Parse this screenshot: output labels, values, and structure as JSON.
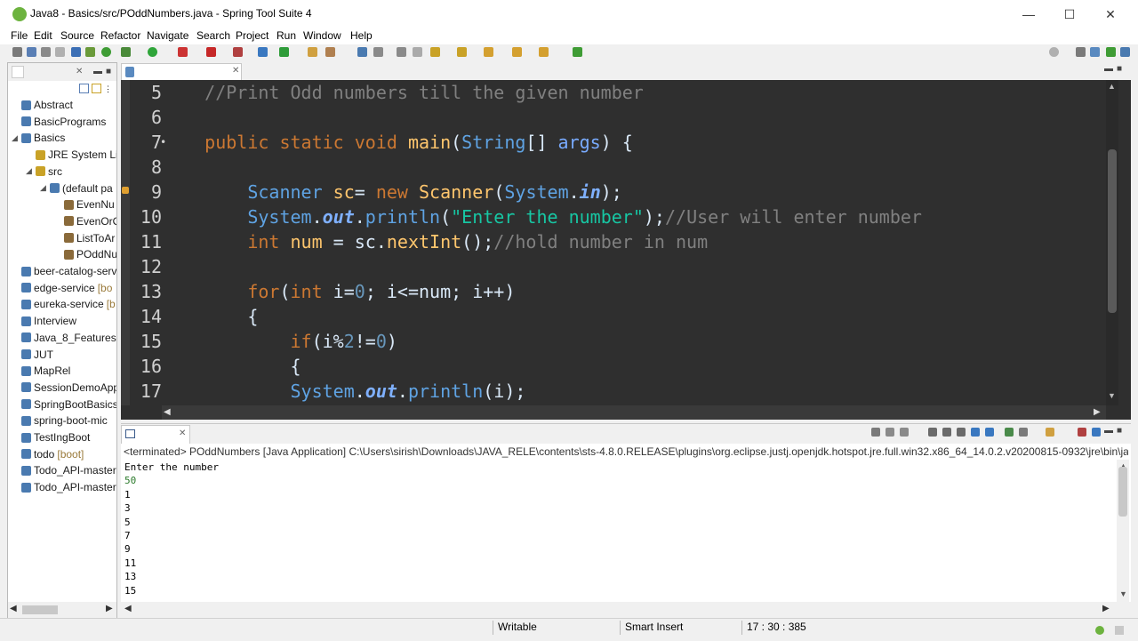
{
  "window": {
    "title": "Java8 - Basics/src/POddNumbers.java - Spring Tool Suite 4",
    "minimize_icon": "minimize-icon",
    "maximize_icon": "maximize-icon",
    "close_icon": "close-icon"
  },
  "menu": [
    "File",
    "Edit",
    "Source",
    "Refactor",
    "Navigate",
    "Search",
    "Project",
    "Run",
    "Window",
    "Help"
  ],
  "package_explorer": {
    "items": [
      {
        "label": "Abstract",
        "level": 0
      },
      {
        "label": "BasicPrograms",
        "level": 0
      },
      {
        "label": "Basics",
        "level": 0,
        "expanded": true
      },
      {
        "label": "JRE System Lib",
        "level": 1
      },
      {
        "label": "src",
        "level": 1,
        "expanded": true
      },
      {
        "label": "(default pa",
        "level": 2,
        "expanded": true
      },
      {
        "label": "EvenNu",
        "level": 3
      },
      {
        "label": "EvenOrO",
        "level": 3
      },
      {
        "label": "ListToAr",
        "level": 3
      },
      {
        "label": "POddNu",
        "level": 3
      },
      {
        "label": "beer-catalog-serv",
        "level": 0
      },
      {
        "label": "edge-service",
        "level": 0,
        "decoration": "[bo"
      },
      {
        "label": "eureka-service",
        "level": 0,
        "decoration": "[b"
      },
      {
        "label": "Interview",
        "level": 0
      },
      {
        "label": "Java_8_Features",
        "level": 0
      },
      {
        "label": "JUT",
        "level": 0
      },
      {
        "label": "MapRel",
        "level": 0
      },
      {
        "label": "SessionDemoApp",
        "level": 0
      },
      {
        "label": "SpringBootBasics",
        "level": 0
      },
      {
        "label": "spring-boot-mic",
        "level": 0
      },
      {
        "label": "TestIngBoot",
        "level": 0
      },
      {
        "label": "todo",
        "level": 0,
        "decoration": "[boot]"
      },
      {
        "label": "Todo_API-master",
        "level": 0
      },
      {
        "label": "Todo_API-master",
        "level": 0
      }
    ]
  },
  "editor": {
    "lines": [
      {
        "n": "5",
        "tokens": [
          [
            "cm",
            "    //Print Odd numbers till the given number"
          ]
        ]
      },
      {
        "n": "6",
        "tokens": []
      },
      {
        "n": "7",
        "marker": "•",
        "tokens": [
          [
            "kw",
            "    public static void "
          ],
          [
            "fn",
            "main"
          ],
          [
            "pl",
            "("
          ],
          [
            "ty",
            "String"
          ],
          [
            "pl",
            "[] "
          ],
          [
            "vr",
            "args"
          ],
          [
            "pl",
            ") {"
          ]
        ]
      },
      {
        "n": "8",
        "tokens": []
      },
      {
        "n": "9",
        "tokens": [
          [
            "ty",
            "        Scanner "
          ],
          [
            "fn",
            "sc"
          ],
          [
            "pl",
            "= "
          ],
          [
            "kw",
            "new "
          ],
          [
            "fn",
            "Scanner"
          ],
          [
            "pl",
            "("
          ],
          [
            "ty",
            "System"
          ],
          [
            "pl",
            "."
          ],
          [
            "it",
            "in"
          ],
          [
            "pl",
            ");"
          ]
        ]
      },
      {
        "n": "10",
        "tokens": [
          [
            "ty",
            "        System"
          ],
          [
            "pl",
            "."
          ],
          [
            "it",
            "out"
          ],
          [
            "pl",
            "."
          ],
          [
            "ty",
            "println"
          ],
          [
            "pl",
            "("
          ],
          [
            "st",
            "\"Enter the number\""
          ],
          [
            "pl",
            ");"
          ],
          [
            "cm",
            "//User will enter number"
          ]
        ]
      },
      {
        "n": "11",
        "tokens": [
          [
            "kw",
            "        int "
          ],
          [
            "fn",
            "num"
          ],
          [
            "pl",
            " = sc."
          ],
          [
            "fn",
            "nextInt"
          ],
          [
            "pl",
            "();"
          ],
          [
            "cm",
            "//hold number in num"
          ]
        ]
      },
      {
        "n": "12",
        "tokens": []
      },
      {
        "n": "13",
        "tokens": [
          [
            "kw",
            "        for"
          ],
          [
            "pl",
            "("
          ],
          [
            "kw",
            "int "
          ],
          [
            "pl",
            "i="
          ],
          [
            "nm",
            "0"
          ],
          [
            "pl",
            "; i<=num; i++)"
          ]
        ]
      },
      {
        "n": "14",
        "tokens": [
          [
            "pl",
            "        {"
          ]
        ]
      },
      {
        "n": "15",
        "tokens": [
          [
            "kw",
            "            if"
          ],
          [
            "pl",
            "(i%"
          ],
          [
            "nm",
            "2"
          ],
          [
            "pl",
            "!="
          ],
          [
            "nm",
            "0"
          ],
          [
            "pl",
            ")"
          ]
        ]
      },
      {
        "n": "16",
        "tokens": [
          [
            "pl",
            "            {"
          ]
        ]
      },
      {
        "n": "17",
        "tokens": [
          [
            "ty",
            "            System"
          ],
          [
            "pl",
            "."
          ],
          [
            "it",
            "out"
          ],
          [
            "pl",
            "."
          ],
          [
            "ty",
            "println"
          ],
          [
            "pl",
            "(i);"
          ]
        ]
      }
    ]
  },
  "console": {
    "header": "<terminated> POddNumbers [Java Application] C:\\Users\\sirish\\Downloads\\JAVA_RELE\\contents\\sts-4.8.0.RELEASE\\plugins\\org.eclipse.justj.openjdk.hotspot.jre.full.win32.x86_64_14.0.2.v20200815-0932\\jre\\bin\\javaw.",
    "output": [
      {
        "text": "Enter the number",
        "type": "out"
      },
      {
        "text": "50",
        "type": "in"
      },
      {
        "text": "1",
        "type": "out"
      },
      {
        "text": "3",
        "type": "out"
      },
      {
        "text": "5",
        "type": "out"
      },
      {
        "text": "7",
        "type": "out"
      },
      {
        "text": "9",
        "type": "out"
      },
      {
        "text": "11",
        "type": "out"
      },
      {
        "text": "13",
        "type": "out"
      },
      {
        "text": "15",
        "type": "out"
      }
    ]
  },
  "status": {
    "writable": "Writable",
    "insert_mode": "Smart Insert",
    "position": "17 : 30 : 385"
  },
  "colors": {
    "editor_bg": "#2f2f2f",
    "keyword": "#cc7832",
    "string": "#17c6a3",
    "comment": "#808080"
  }
}
